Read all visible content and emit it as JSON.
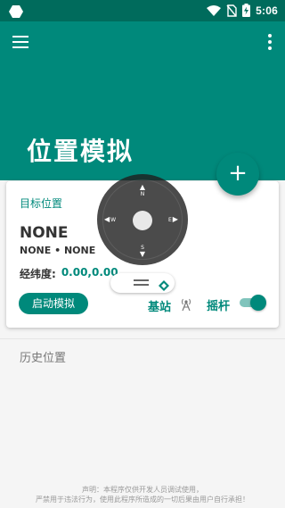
{
  "status_bar": {
    "time": "5:06",
    "icons": [
      "app-notification-icon",
      "wifi-icon",
      "no-sim-icon",
      "battery-charging-icon"
    ]
  },
  "app_bar": {
    "title": "位置模拟",
    "menu_icon": "hamburger-menu-icon",
    "more_icon": "more-vert-icon",
    "color": "#00897b"
  },
  "fab": {
    "label": "+"
  },
  "card": {
    "label": "目标位置",
    "name": "NONE",
    "sub": "NONE • NONE",
    "coord_label": "经纬度:",
    "coord_value": "0.00,0.00",
    "start_button": "启动模拟",
    "station_label": "基站",
    "joystick_label": "摇杆",
    "joystick_enabled": true
  },
  "joystick": {
    "north": "N",
    "south": "S",
    "west": "W",
    "east": "E"
  },
  "history": {
    "label": "历史位置"
  },
  "footer": {
    "line1": "声明：本程序仅供开发人员调试使用，",
    "line2": "严禁用于违法行为，使用此程序所造成的一切后果由用户自行承担！"
  },
  "colors": {
    "primary": "#00897b",
    "dark": "#006b5c",
    "accent_light": "#80c4bc"
  }
}
